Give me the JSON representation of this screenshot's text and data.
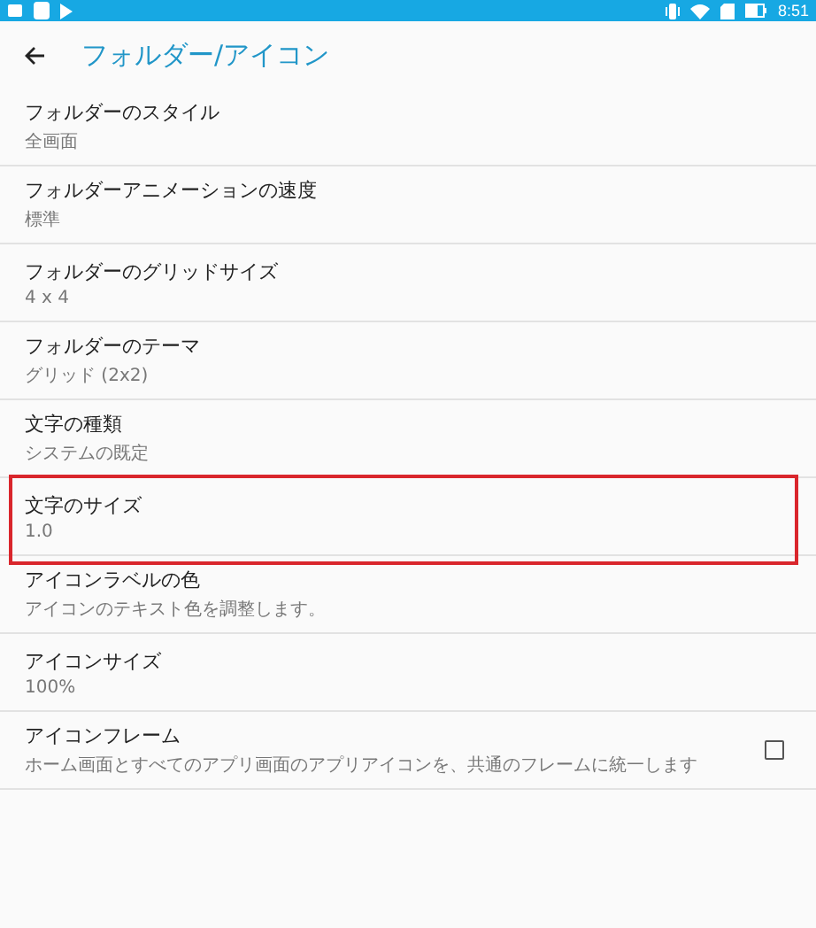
{
  "status_bar": {
    "time": "8:51"
  },
  "header": {
    "title": "フォルダー/アイコン"
  },
  "settings": [
    {
      "kind": "text",
      "title": "フォルダーのスタイル",
      "summary": "全画面",
      "highlighted": false
    },
    {
      "kind": "text",
      "title": "フォルダーアニメーションの速度",
      "summary": "標準",
      "highlighted": false
    },
    {
      "kind": "text",
      "title": "フォルダーのグリッドサイズ",
      "summary": "4 x 4",
      "highlighted": false
    },
    {
      "kind": "text",
      "title": "フォルダーのテーマ",
      "summary": "グリッド (2x2)",
      "highlighted": false
    },
    {
      "kind": "text",
      "title": "文字の種類",
      "summary": "システムの既定",
      "highlighted": false
    },
    {
      "kind": "text",
      "title": "文字のサイズ",
      "summary": "1.0",
      "highlighted": true
    },
    {
      "kind": "text",
      "title": "アイコンラベルの色",
      "summary": "アイコンのテキスト色を調整します。",
      "highlighted": false
    },
    {
      "kind": "text",
      "title": "アイコンサイズ",
      "summary": "100%",
      "highlighted": false
    },
    {
      "kind": "checkbox",
      "title": "アイコンフレーム",
      "summary": "ホーム画面とすべてのアプリ画面のアプリアイコンを、共通のフレームに統一します",
      "checked": false,
      "highlighted": false
    }
  ]
}
